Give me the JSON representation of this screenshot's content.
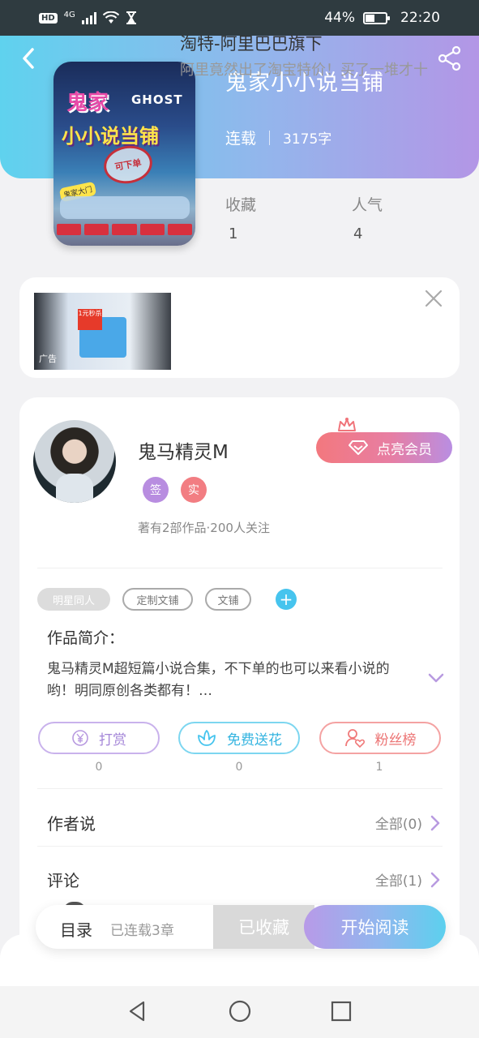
{
  "status_bar": {
    "network_badge": "HD",
    "network_type": "4G",
    "battery_percent": "44%",
    "time": "22:20",
    "icons": [
      "signal-icon",
      "wifi-icon",
      "hourglass-icon",
      "battery-icon"
    ]
  },
  "header": {
    "back_icon": "chevron-left-icon",
    "share_icon": "share-icon",
    "gradient": [
      "#5fd2ee",
      "#b396e6"
    ]
  },
  "book": {
    "title": "鬼家小小说当铺",
    "status": "连载",
    "word_count": "3175字",
    "cover": {
      "title_line1": "鬼家",
      "title_en": "GHOST",
      "title_line2": "小小说当铺",
      "stamp": "可下单",
      "tag": "鬼家大门"
    },
    "stats": [
      {
        "label": "收藏",
        "value": "1"
      },
      {
        "label": "人气",
        "value": "4"
      }
    ]
  },
  "ad": {
    "title": "淘特-阿里巴巴旗下",
    "description": "阿里竟然出了淘宝特价！买了一堆才十",
    "tag": "广告",
    "image_price": "1元秒杀",
    "close_icon": "close-icon"
  },
  "author": {
    "name": "鬼马精灵M",
    "badges": [
      {
        "text": "签",
        "color": "#b88de0"
      },
      {
        "text": "实",
        "color": "#f27d82"
      }
    ],
    "info": "著有2部作品·200人关注",
    "vip_button": "点亮会员"
  },
  "tags": [
    {
      "label": "明星同人",
      "style": "filled"
    },
    {
      "label": "定制文铺",
      "style": "outline"
    },
    {
      "label": "文铺",
      "style": "outline"
    }
  ],
  "intro": {
    "label": "作品简介：",
    "text": "鬼马精灵M超短篇小说合集，不下单的也可以来看小说的哟！明同原创各类都有！…"
  },
  "actions": [
    {
      "label": "打赏",
      "count": "0",
      "color": "#b89ae0",
      "icon": "yen-icon"
    },
    {
      "label": "免费送花",
      "count": "0",
      "color": "#46c4ee",
      "icon": "flower-icon"
    },
    {
      "label": "粉丝榜",
      "count": "1",
      "color": "#f07a7a",
      "icon": "fan-heart-icon"
    }
  ],
  "author_says": {
    "label": "作者说",
    "link": "全部(0)"
  },
  "comments": {
    "label": "评论",
    "link": "全部(1)"
  },
  "bottom_bar": {
    "toc_label": "目录",
    "toc_status": "已连载3章",
    "collected_button": "已收藏",
    "read_button": "开始阅读"
  },
  "nav": [
    "back-nav-icon",
    "home-nav-icon",
    "recent-nav-icon"
  ]
}
